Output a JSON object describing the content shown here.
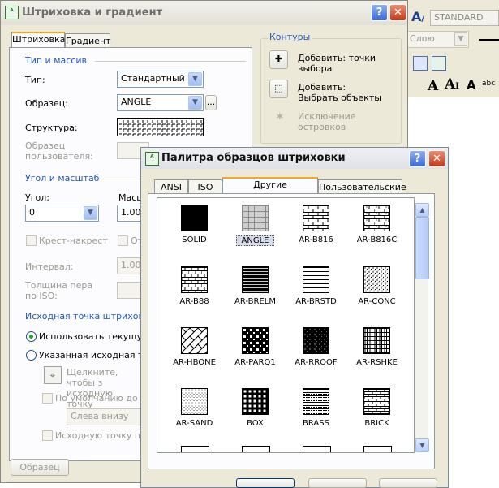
{
  "bg_app": {
    "style_name": "STANDARD",
    "layer_combo": "Слою"
  },
  "hatch_dialog": {
    "title": "Штриховка и градиент",
    "tabs": [
      {
        "label": "Штриховка"
      },
      {
        "label": "Градиент"
      }
    ],
    "type_group": {
      "heading": "Тип и массив",
      "type_label": "Тип:",
      "type_value": "Стандартный",
      "pattern_label": "Образец:",
      "pattern_value": "ANGLE",
      "browse_label": "...",
      "structure_label": "Структура:",
      "custom_label": "Образец пользователя:"
    },
    "angle_group": {
      "heading": "Угол и масштаб",
      "angle_label": "Угол:",
      "angle_value": "0",
      "scale_label": "Масш",
      "scale_value": "1.000",
      "crosshatch_label": "Крест-накрест",
      "relative_label": "От",
      "spacing_label": "Интервал:",
      "spacing_value": "1.000",
      "pen_width_label": "Толщина пера по ISO:"
    },
    "origin_group": {
      "heading": "Исходная точка штриховки",
      "use_current_label": "Использовать текущую и",
      "specified_label": "Указанная исходная точк",
      "click_hint": "Щелкните, чтобы з исходную точку",
      "default_extents_label": "По умолчанию до кон",
      "position_value": "Слева внизу",
      "store_label": "Исходную точку по ум"
    },
    "contours": {
      "heading": "Контуры",
      "add_points_label": "Добавить: точки выбора",
      "add_objects_label": "Добавить: Выбрать объекты",
      "remove_islands_label": "Исключение островков"
    },
    "preview_button": "Образец"
  },
  "palette": {
    "title": "Палитра образцов штриховки",
    "tabs": [
      {
        "label": "ANSI"
      },
      {
        "label": "ISO"
      },
      {
        "label": "Другие стандартные"
      },
      {
        "label": "Пользовательские"
      }
    ],
    "patterns": [
      {
        "name": "SOLID"
      },
      {
        "name": "ANGLE"
      },
      {
        "name": "AR-B816"
      },
      {
        "name": "AR-B816C"
      },
      {
        "name": "AR-B88"
      },
      {
        "name": "AR-BRELM"
      },
      {
        "name": "AR-BRSTD"
      },
      {
        "name": "AR-CONC"
      },
      {
        "name": "AR-HBONE"
      },
      {
        "name": "AR-PARQ1"
      },
      {
        "name": "AR-RROOF"
      },
      {
        "name": "AR-RSHKE"
      },
      {
        "name": "AR-SAND"
      },
      {
        "name": "BOX"
      },
      {
        "name": "BRASS"
      },
      {
        "name": "BRICK"
      }
    ],
    "selected": "ANGLE"
  },
  "icons": {
    "app": "autocad-icon",
    "help": "question-mark-icon",
    "close": "close-x-icon"
  }
}
